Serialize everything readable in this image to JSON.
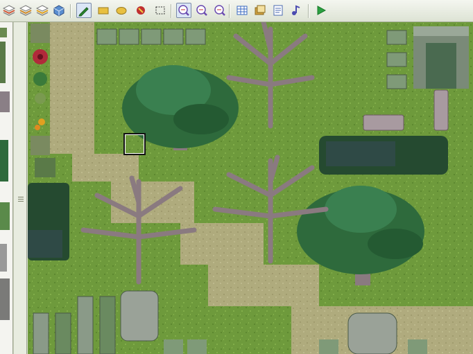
{
  "toolbar": {
    "tools": [
      {
        "name": "layer-1-icon",
        "kind": "layer",
        "color": "#d0583a"
      },
      {
        "name": "layer-2-icon",
        "kind": "layer",
        "color": "#d08a2a"
      },
      {
        "name": "layer-3-icon",
        "kind": "layer",
        "color": "#e0a020"
      },
      {
        "name": "events-layer-icon",
        "kind": "cube",
        "color": "#5a8ed0"
      },
      {
        "name": "pencil-icon",
        "kind": "pencil",
        "color": "#2a8a30",
        "active": true
      },
      {
        "name": "rectangle-icon",
        "kind": "rect",
        "color": "#e8c040"
      },
      {
        "name": "ellipse-icon",
        "kind": "ellipse",
        "color": "#e8c040"
      },
      {
        "name": "flood-fill-icon",
        "kind": "fill",
        "color": "#c03030"
      },
      {
        "name": "select-icon",
        "kind": "select",
        "color": "#303030"
      },
      {
        "name": "zoom-1x-icon",
        "kind": "zoom",
        "color": "#6a4ab0",
        "active": true
      },
      {
        "name": "zoom-half-icon",
        "kind": "zoom",
        "color": "#6a4ab0"
      },
      {
        "name": "zoom-quarter-icon",
        "kind": "zoom",
        "color": "#6a4ab0"
      },
      {
        "name": "database-icon",
        "kind": "grid",
        "color": "#3a6ac0"
      },
      {
        "name": "resource-manager-icon",
        "kind": "folder",
        "color": "#d0a040"
      },
      {
        "name": "script-editor-icon",
        "kind": "doc",
        "color": "#4a6ab0"
      },
      {
        "name": "sound-test-icon",
        "kind": "note",
        "color": "#4a4ab0"
      },
      {
        "name": "play-test-icon",
        "kind": "play",
        "color": "#2aa040"
      }
    ]
  },
  "colors": {
    "grass": "#6e9a3c",
    "path": "#b7ad85",
    "pit": "#2f4a46",
    "trunk": "#8a7a80",
    "leaves": "#2e6a3c"
  }
}
